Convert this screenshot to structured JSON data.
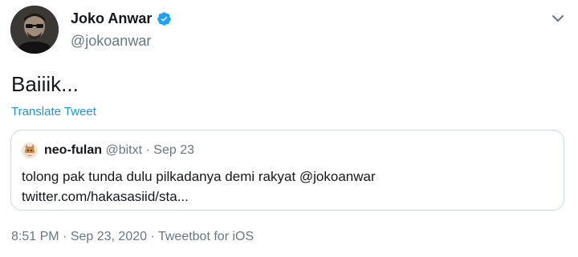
{
  "author": {
    "display_name": "Joko Anwar",
    "handle": "@jokoanwar",
    "verified": true
  },
  "tweet": {
    "text": "Baiiik...",
    "translate_label": "Translate Tweet"
  },
  "quoted_tweet": {
    "display_name": "neo-fulan",
    "handle": "@bitxt",
    "separator": "·",
    "date": "Sep 23",
    "text_line1": "tolong pak tunda dulu pilkadanya demi rakyat @jokoanwar",
    "text_line2": "twitter.com/hakasasiid/sta..."
  },
  "footer": {
    "time": "8:51 PM",
    "separator": "·",
    "date": "Sep 23, 2020",
    "source": "Tweetbot for iOS"
  },
  "colors": {
    "link": "#1b95e0",
    "verified_badge": "#1da1f2",
    "secondary_text": "#657786",
    "border": "#ccd6dd"
  },
  "icons": {
    "verified": "verified-badge-icon",
    "menu": "chevron-down-icon"
  }
}
